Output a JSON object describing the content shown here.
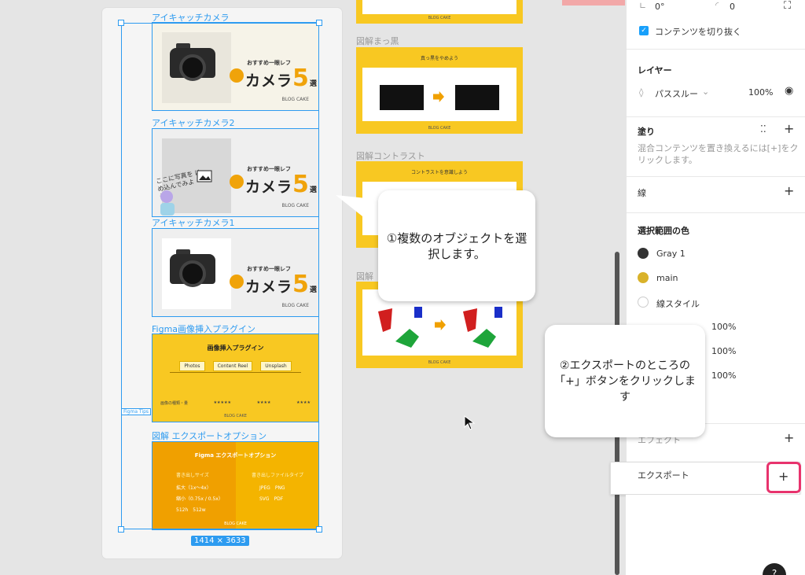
{
  "canvas": {
    "frames": [
      {
        "label": "アイキャッチカメラ"
      },
      {
        "label": "アイキャッチカメラ2"
      },
      {
        "label": "アイキャッチカメラ1"
      },
      {
        "label": "Figma画像挿入プラグイン"
      },
      {
        "label": "図解 エクスポートオプション"
      }
    ],
    "camera_card": {
      "subtitle": "おすすめ一眼レフ",
      "big": "カメラ",
      "number": "5",
      "suffix": "選",
      "brand": "BLOG CAKE",
      "placeholder_text": "ここに写真を はめ込んでみよう！"
    },
    "plugin_card": {
      "title": "画像挿入プラグイン",
      "tags": [
        "Photos",
        "Content Reel",
        "Unsplash"
      ],
      "rating_label": "画像の種類・量",
      "stars": [
        "★★★★★",
        "★★★★",
        "★★★★"
      ],
      "brand": "BLOG CAKE"
    },
    "export_card": {
      "title": "Figma エクスポートオプション",
      "left_head": "書き出しサイズ",
      "left_lines": [
        "拡大（1x〜4x）",
        "縮小（0.75x / 0.5x）",
        "512h　512w"
      ],
      "right_head": "書き出しファイルタイプ",
      "right_lines": [
        "JPEG　PNG",
        "SVG　PDF"
      ],
      "brand": "BLOG CAKE"
    },
    "figma_tips_tag": "Figma Tips",
    "size_badge": "1414 × 3633",
    "right_frames": [
      {
        "label": "図解まっ黒",
        "band": "真っ黒をやめよう"
      },
      {
        "label": "図解コントラスト",
        "band": "コントラストを意識しよう"
      },
      {
        "label": "図解"
      }
    ],
    "brand_small": "BLOG CAKE"
  },
  "callouts": {
    "one": "①複数のオブジェクトを選択します。",
    "two": "②エクスポートのところの「+」ボタンをクリックします"
  },
  "panel": {
    "rotation": "0°",
    "radius": "0",
    "clip_content": "コンテンツを切り抜く",
    "layer_title": "レイヤー",
    "blend_mode": "パススルー",
    "opacity": "100%",
    "fill_title": "塗り",
    "fill_hint": "混合コンテンツを置き換えるには[+]をクリックします。",
    "stroke_title": "線",
    "selection_colors_title": "選択範囲の色",
    "colors": [
      {
        "name": "Gray 1",
        "hex": "#333333"
      },
      {
        "name": "main",
        "hex": "#d9b22a"
      },
      {
        "name": "線スタイル",
        "hex": "#ffffff"
      }
    ],
    "percent_rows": [
      "100%",
      "100%",
      "100%"
    ],
    "effects_partial": "エフェクト",
    "export_title": "エクスポート",
    "accent": "#18a0fb",
    "highlight": "#e8336d"
  }
}
